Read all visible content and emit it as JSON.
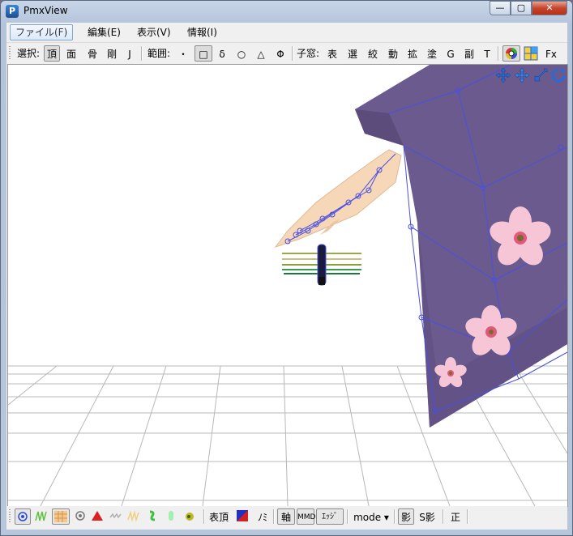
{
  "window": {
    "title": "PmxView"
  },
  "menu": [
    "ファイル(F)",
    "編集(E)",
    "表示(V)",
    "情報(I)"
  ],
  "toolbar": {
    "select_label": "選択:",
    "select_items": [
      "頂",
      "面",
      "骨",
      "剛",
      "J"
    ],
    "range_label": "範囲:",
    "range_items": [
      "・",
      "□",
      "δ",
      "○",
      "△",
      "Φ"
    ],
    "child_label": "子窓:",
    "child_items": [
      "表",
      "選",
      "絞",
      "動",
      "拡",
      "塗",
      "G",
      "副",
      "T"
    ],
    "fx_label": "Fx"
  },
  "statusbar": {
    "face_vertex_label": "表頂",
    "nomi_label": "ﾉﾐ",
    "axis_label": "軸",
    "mmd_label": "MMD",
    "edge_label": "ｴｯｼﾞ",
    "mode_label": "mode ▾",
    "shadow_label": "影",
    "sshadow_label": "S影",
    "sei_label": "正"
  },
  "colors": {
    "kimono": "#6b5a8e",
    "wire": "#4a50e0",
    "skin": "#f6d8b8",
    "blossom": "#f4c4d4"
  }
}
